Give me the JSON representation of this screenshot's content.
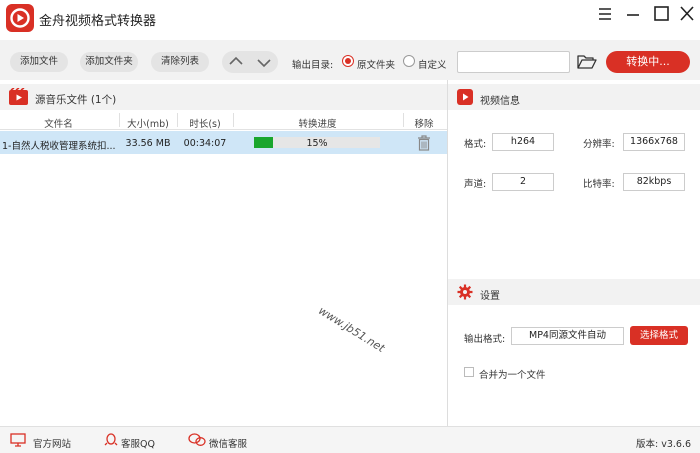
{
  "app": {
    "title": "金舟视频格式转换器"
  },
  "toolbar": {
    "add_file": "添加文件",
    "add_folder": "添加文件夹",
    "clear_list": "清除列表",
    "output_dir_label": "输出目录:",
    "radio_source": "原文件夹",
    "radio_custom": "自定义",
    "output_path": "",
    "convert_label": "转换中..."
  },
  "file_list": {
    "title": "源音乐文件 (1个)",
    "columns": [
      "文件名",
      "大小(mb)",
      "时长(s)",
      "转换进度",
      "移除"
    ],
    "rows": [
      {
        "name": "1-自然人税收管理系统扣...",
        "size": "33.56 MB",
        "duration": "00:34:07",
        "progress_text": "15%",
        "progress": 0.15
      }
    ]
  },
  "watermark": "www.jb51.net",
  "video_info": {
    "title": "视频信息",
    "format_label": "格式:",
    "format_value": "h264",
    "resolution_label": "分辨率:",
    "resolution_value": "1366x768",
    "channels_label": "声道:",
    "channels_value": "2",
    "bitrate_label": "比特率:",
    "bitrate_value": "82kbps"
  },
  "settings": {
    "title": "设置",
    "output_format_label": "输出格式:",
    "output_format_value": "MP4同源文件自动",
    "select_format_button": "选择格式",
    "merge_label": "合并为一个文件"
  },
  "statusbar": {
    "website": "官方网站",
    "qq": "客服QQ",
    "wechat": "微信客服",
    "version": "版本: v3.6.6"
  },
  "colors": {
    "accent": "#d93025",
    "progress": "#1aa62d",
    "selected_row": "#cfe6f7"
  }
}
